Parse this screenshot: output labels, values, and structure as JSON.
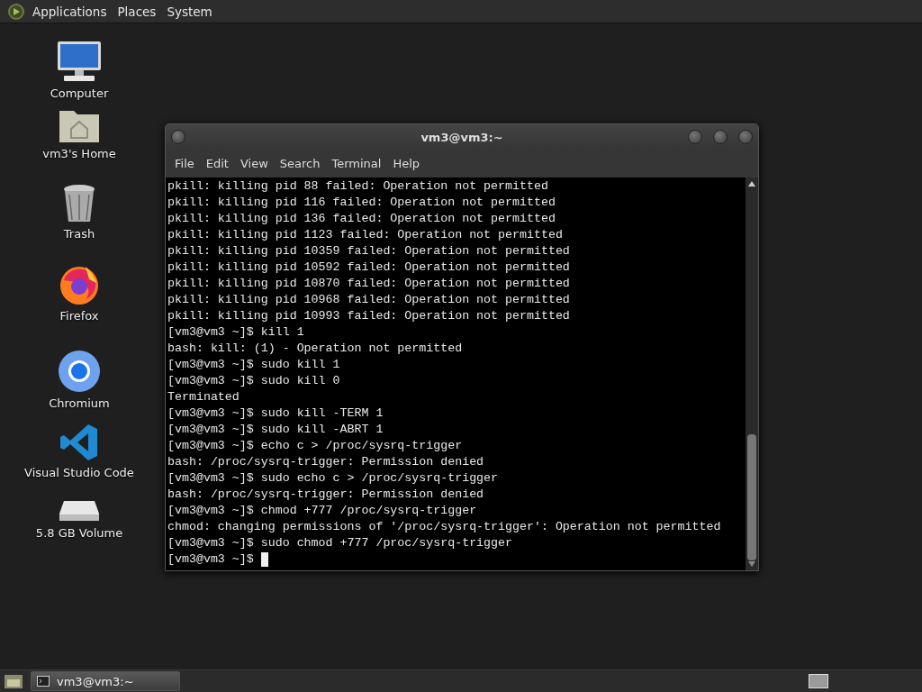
{
  "top_panel": {
    "menus": [
      "Applications",
      "Places",
      "System"
    ]
  },
  "desktop_icons": [
    {
      "kind": "computer",
      "label": "Computer"
    },
    {
      "kind": "home",
      "label": "vm3's Home"
    },
    {
      "kind": "trash",
      "label": "Trash"
    },
    {
      "kind": "firefox",
      "label": "Firefox"
    },
    {
      "kind": "chromium",
      "label": "Chromium"
    },
    {
      "kind": "vscode",
      "label": "Visual Studio Code"
    },
    {
      "kind": "drive",
      "label": "5.8 GB Volume"
    }
  ],
  "terminal": {
    "title": "vm3@vm3:~",
    "menu": [
      "File",
      "Edit",
      "View",
      "Search",
      "Terminal",
      "Help"
    ],
    "lines": [
      "pkill: killing pid 88 failed: Operation not permitted",
      "pkill: killing pid 116 failed: Operation not permitted",
      "pkill: killing pid 136 failed: Operation not permitted",
      "pkill: killing pid 1123 failed: Operation not permitted",
      "pkill: killing pid 10359 failed: Operation not permitted",
      "pkill: killing pid 10592 failed: Operation not permitted",
      "pkill: killing pid 10870 failed: Operation not permitted",
      "pkill: killing pid 10968 failed: Operation not permitted",
      "pkill: killing pid 10993 failed: Operation not permitted",
      "[vm3@vm3 ~]$ kill 1",
      "bash: kill: (1) - Operation not permitted",
      "[vm3@vm3 ~]$ sudo kill 1",
      "[vm3@vm3 ~]$ sudo kill 0",
      "Terminated",
      "[vm3@vm3 ~]$ sudo kill -TERM 1",
      "[vm3@vm3 ~]$ sudo kill -ABRT 1",
      "[vm3@vm3 ~]$ echo c > /proc/sysrq-trigger",
      "bash: /proc/sysrq-trigger: Permission denied",
      "[vm3@vm3 ~]$ sudo echo c > /proc/sysrq-trigger",
      "bash: /proc/sysrq-trigger: Permission denied",
      "[vm3@vm3 ~]$ chmod +777 /proc/sysrq-trigger",
      "chmod: changing permissions of '/proc/sysrq-trigger': Operation not permitted",
      "[vm3@vm3 ~]$ sudo chmod +777 /proc/sysrq-trigger",
      "[vm3@vm3 ~]$ "
    ],
    "cursor": true
  },
  "bottom_panel": {
    "tasks": [
      {
        "label": "vm3@vm3:~",
        "selected": true
      }
    ]
  }
}
